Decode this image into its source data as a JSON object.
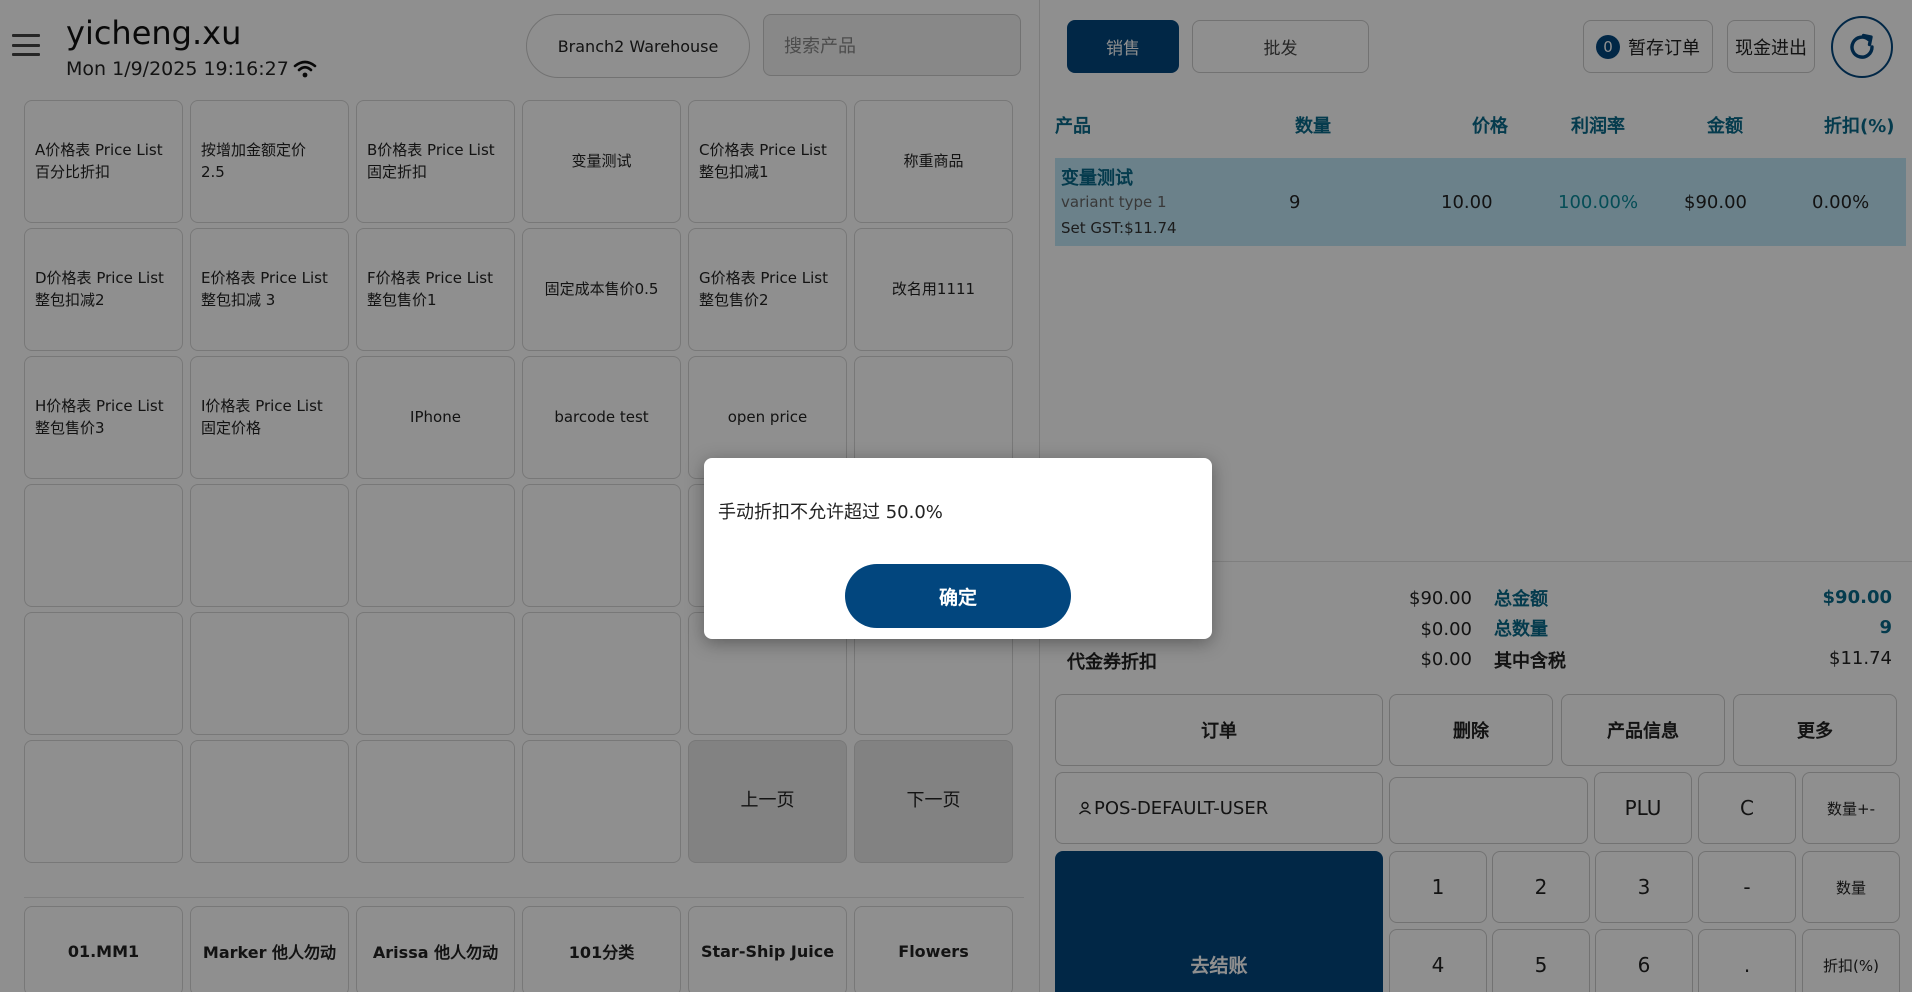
{
  "header": {
    "user_name": "yicheng.xu",
    "datetime": "Mon 1/9/2025 19:16:27",
    "warehouse": "Branch2 Warehouse",
    "search_placeholder": "搜索产品"
  },
  "products": [
    "A价格表 Price List\n百分比折扣",
    "按增加金额定价\n2.5",
    "B价格表 Price List\n固定折扣",
    "变量测试",
    "C价格表 Price List\n整包扣减1",
    "称重商品",
    "D价格表 Price List\n整包扣减2",
    "E价格表 Price List\n整包扣减 3",
    "F价格表 Price List\n整包售价1",
    "固定成本售价0.5",
    "G价格表 Price List\n整包售价2",
    "改名用1111",
    "H价格表 Price List\n整包售价3",
    "I价格表 Price List\n固定价格",
    "IPhone",
    "barcode test",
    "open price",
    "",
    "",
    "",
    "",
    "",
    "",
    "",
    "",
    "",
    "",
    "",
    "",
    "",
    "",
    "",
    "",
    "",
    "上一页",
    "下一页"
  ],
  "categories": [
    "01.MM1",
    "Marker 他人勿动",
    "Arissa 他人勿动",
    "101分类",
    "Star-Ship Juice",
    "Flowers"
  ],
  "top_bar": {
    "sale": "销售",
    "wholesale": "批发",
    "hold_count": "0",
    "hold_label": "暂存订单",
    "cash": "现金进出"
  },
  "order_columns": {
    "product": "产品",
    "qty": "数量",
    "price": "价格",
    "margin": "利润率",
    "amount": "金额",
    "discount": "折扣(%)"
  },
  "order_items": [
    {
      "name": "变量测试",
      "variant": "variant type 1",
      "gst": "Set GST:$11.74",
      "qty": "9",
      "price": "10.00",
      "margin": "100.00%",
      "amount": "$90.00",
      "discount": "0.00%"
    }
  ],
  "summary": {
    "subtotal_val": "$90.00",
    "discount_val": "$0.00",
    "voucher_label": "代金券折扣",
    "voucher_val": "$0.00",
    "total_label": "总金额",
    "total_val": "$90.00",
    "total_qty_label": "总数量",
    "total_qty_val": "9",
    "tax_label": "其中含税",
    "tax_val": "$11.74"
  },
  "actions": {
    "orders": "订单",
    "delete": "删除",
    "product_info": "产品信息",
    "more": "更多",
    "pos_user": "POS-DEFAULT-USER",
    "plu": "PLU",
    "clear": "C",
    "qty_pm": "数量+-",
    "qty": "数量",
    "discount": "折扣(%)",
    "checkout": "去结账",
    "keys": [
      "1",
      "2",
      "3",
      "-",
      "4",
      "5",
      "6",
      "."
    ]
  },
  "dialog": {
    "message": "手动折扣不允许超过 50.0%",
    "ok": "确定"
  },
  "colors": {
    "brand": "#02467e",
    "accent_text": "#0a6a8a",
    "selected_row": "#bfe6f7"
  }
}
